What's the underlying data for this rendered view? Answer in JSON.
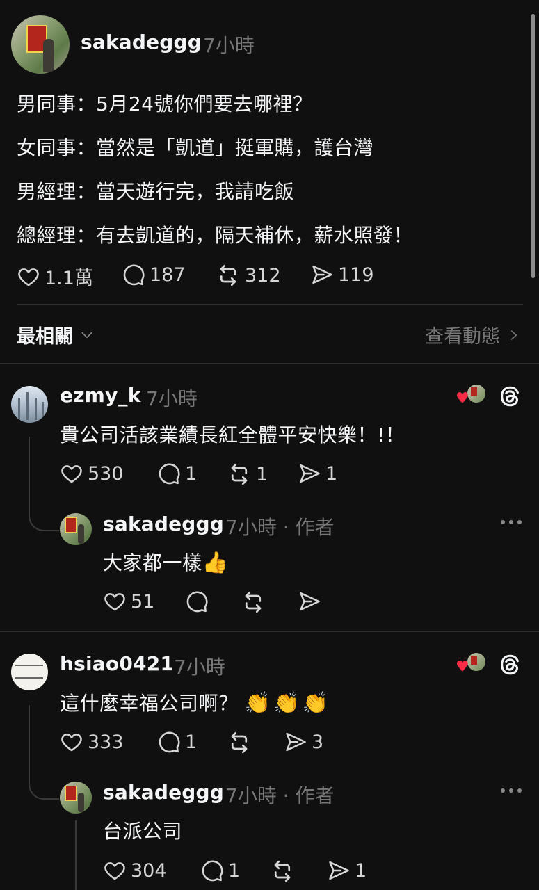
{
  "post": {
    "username": "sakadeggg",
    "time": "7小時",
    "lines": [
      "男同事：5月24號你們要去哪裡？",
      "女同事：當然是「凱道」挺軍購，護台灣",
      "男經理：當天遊行完，我請吃飯",
      "總經理：有去凱道的，隔天補休，薪水照發！"
    ],
    "likes": "1.1萬",
    "replies": "187",
    "reposts": "312",
    "shares": "119"
  },
  "sort": {
    "label": "最相關",
    "activity_label": "查看動態"
  },
  "comments": [
    {
      "username": "ezmy_k",
      "time": "7小時",
      "text": "貴公司活該業績長紅全體平安快樂！!！",
      "likes": "530",
      "replies": "1",
      "reposts": "1",
      "shares": "1",
      "reply": {
        "username": "sakadeggg",
        "time": "7小時 · 作者",
        "text": "大家都一樣",
        "emoji": "👍",
        "likes": "51"
      }
    },
    {
      "username": "hsiao0421",
      "time": "7小時",
      "text": "這什麼幸福公司啊？",
      "emoji": "👏👏👏",
      "likes": "333",
      "replies": "1",
      "shares": "3",
      "reply": {
        "username": "sakadeggg",
        "time": "7小時 · 作者",
        "text": "台派公司",
        "likes": "304",
        "replies": "1",
        "shares": "1"
      }
    }
  ],
  "icons": {
    "like": "heart-icon",
    "reply": "comment-icon",
    "repost": "repost-icon",
    "share": "share-icon",
    "threads": "threads-logo-icon",
    "more": "more-icon",
    "chevron_down": "chevron-down-icon",
    "chevron_right": "chevron-right-icon"
  },
  "colors": {
    "background": "#101010",
    "text": "#f3f5f7",
    "muted": "#777777",
    "heart_badge": "#ff2a45"
  }
}
